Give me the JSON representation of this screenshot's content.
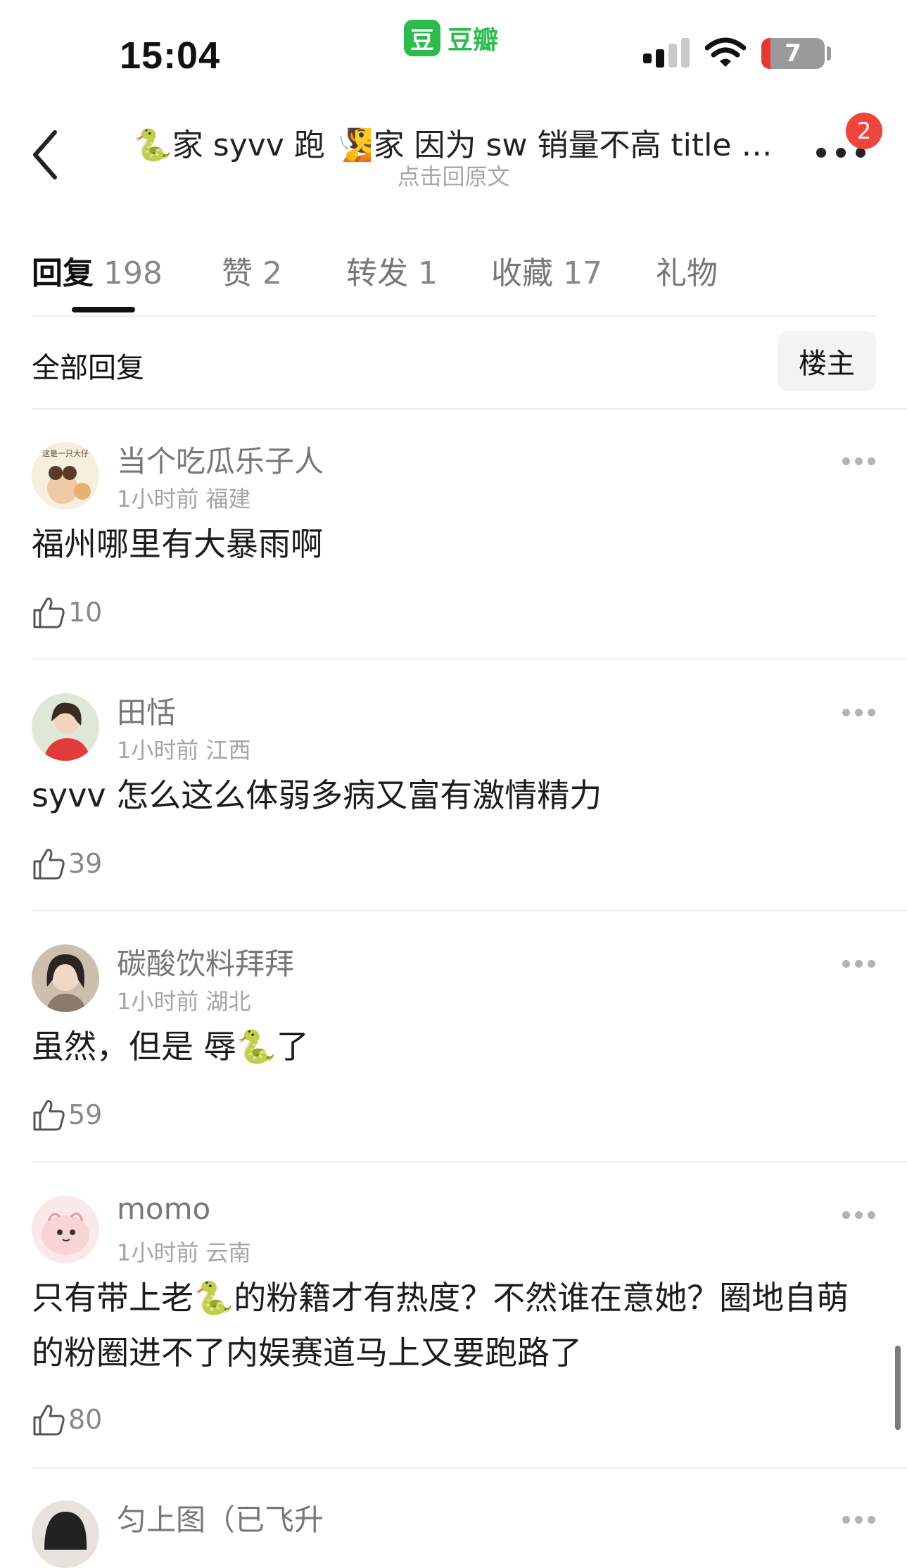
{
  "status_bar": {
    "time": "15:04",
    "app_icon_char": "豆",
    "app_name": "豆瓣",
    "battery_level": "7",
    "battery_fraction": 0.07,
    "app_color": "#2dbb4e"
  },
  "nav": {
    "title": "🐍家 syvv 跑 🧏家 因为 sw 销量不高 title 内…",
    "subtitle": "点击回原文",
    "notification_count": "2"
  },
  "tabs": [
    {
      "label": "回复",
      "count": "198",
      "active": true
    },
    {
      "label": "赞",
      "count": "2",
      "active": false
    },
    {
      "label": "转发",
      "count": "1",
      "active": false
    },
    {
      "label": "收藏",
      "count": "17",
      "active": false
    },
    {
      "label": "礼物",
      "count": "",
      "active": false
    }
  ],
  "filter": {
    "all_replies_label": "全部回复",
    "op_only_label": "楼主"
  },
  "comments": [
    {
      "username": "当个吃瓜乐子人",
      "time": "1小时前",
      "location": "福建",
      "text": "福州哪里有大暴雨啊",
      "likes": "10",
      "avatar_label": "这是一只大仔"
    },
    {
      "username": "田恬",
      "time": "1小时前",
      "location": "江西",
      "text": "syvv 怎么这么体弱多病又富有激情精力",
      "likes": "39"
    },
    {
      "username": "碳酸饮料拜拜",
      "time": "1小时前",
      "location": "湖北",
      "text": "虽然，但是 辱🐍了",
      "likes": "59"
    },
    {
      "username": "momo",
      "time": "1小时前",
      "location": "云南",
      "text": "只有带上老🐍的粉籍才有热度？不然谁在意她？圈地自萌的粉圈进不了内娱赛道马上又要跑路了",
      "likes": "80"
    },
    {
      "username": "匀上图（已飞升",
      "time": "",
      "location": "",
      "text": "",
      "likes": ""
    }
  ],
  "colors": {
    "accent": "#2dbb4e",
    "badge_red": "#f0453c",
    "muted_text": "#a5a5a5"
  },
  "icons": [
    "signal-icon",
    "wifi-icon",
    "battery-icon",
    "back-arrow-icon",
    "more-icon",
    "thumbs-up-icon"
  ]
}
